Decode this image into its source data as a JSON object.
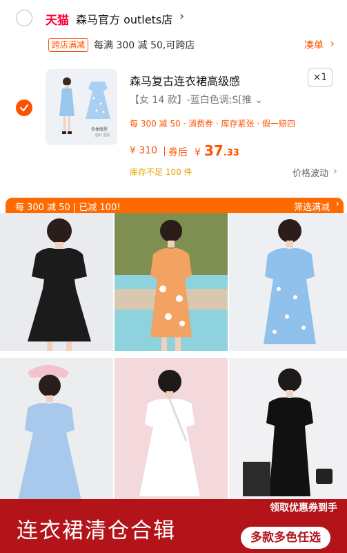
{
  "store": {
    "brand": "天猫",
    "name": "森马官方 outlets店",
    "chevron": "›"
  },
  "promo": {
    "tag": "跨店满减",
    "text": "每满 300 减 50,可跨店",
    "action": "凑单",
    "chevron": "›"
  },
  "product": {
    "thumb_caption": "合体版型",
    "thumb_caption2": "面料 图案",
    "title": "森马复古连衣裙高级感",
    "quantity": "×1",
    "sku": "【女 14 款】-蓝白色调;S[推 ⌄",
    "tags": "每 300 减 50 · 消费券 · 库存紧张 · 假一赔四",
    "orig_price": "¥ 310",
    "after_label": "券后",
    "final_currency": "¥",
    "final_int": "37",
    "final_dec": ".33",
    "stock_warning": "库存不足 100 件",
    "price_fluct": "价格波动",
    "price_fluct_chevron": "›"
  },
  "discount_bar": {
    "left": "每 300 减 50 | 已减 100!",
    "right": "筛选满减",
    "chevron": "›"
  },
  "banner": {
    "subtitle": "领取优惠券到手",
    "title": "连衣裙清仓合辑",
    "button": "多款多色任选"
  },
  "colors": {
    "accent": "#ff5000",
    "bar": "#ff6a00",
    "banner": "#b3141a",
    "tmall": "#ff0036"
  }
}
